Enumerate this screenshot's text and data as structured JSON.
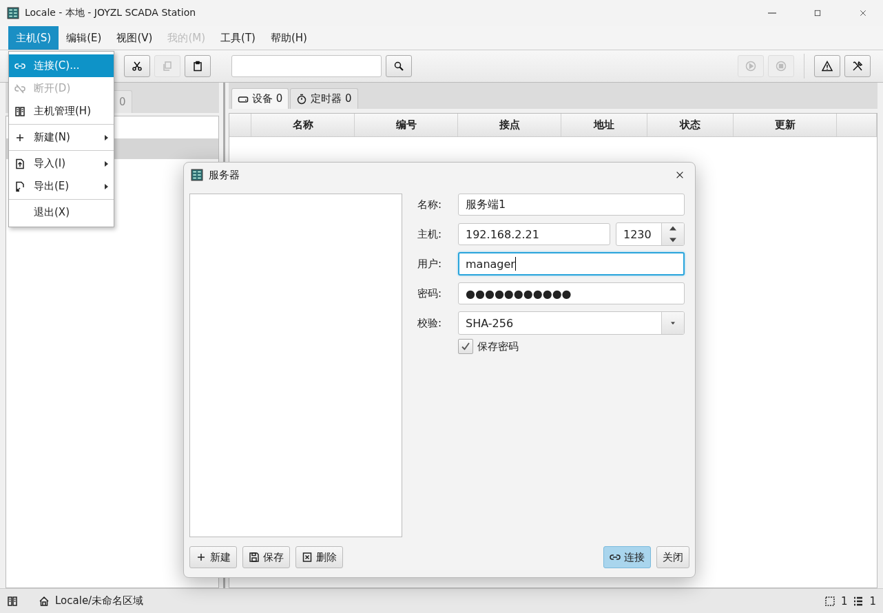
{
  "window": {
    "title": "Locale - 本地 - JOYZL SCADA Station"
  },
  "menubar": [
    {
      "label": "主机(S)",
      "selected": true,
      "disabled": false
    },
    {
      "label": "编辑(E)",
      "selected": false,
      "disabled": false
    },
    {
      "label": "视图(V)",
      "selected": false,
      "disabled": false
    },
    {
      "label": "我的(M)",
      "selected": false,
      "disabled": true
    },
    {
      "label": "工具(T)",
      "selected": false,
      "disabled": false
    },
    {
      "label": "帮助(H)",
      "selected": false,
      "disabled": false
    }
  ],
  "menu": {
    "items": [
      {
        "kind": "connect",
        "label": "连接(C)...",
        "selected": true,
        "disabled": false,
        "submenu": false
      },
      {
        "kind": "disconnect",
        "label": "断开(D)",
        "selected": false,
        "disabled": true,
        "submenu": false
      },
      {
        "kind": "manage",
        "label": "主机管理(H)",
        "selected": false,
        "disabled": false,
        "submenu": false
      },
      {
        "kind": "separator"
      },
      {
        "kind": "new",
        "label": "新建(N)",
        "selected": false,
        "disabled": false,
        "submenu": true
      },
      {
        "kind": "separator"
      },
      {
        "kind": "import",
        "label": "导入(I)",
        "selected": false,
        "disabled": false,
        "submenu": true
      },
      {
        "kind": "export",
        "label": "导出(E)",
        "selected": false,
        "disabled": false,
        "submenu": true
      },
      {
        "kind": "separator"
      },
      {
        "kind": "exit",
        "label": "退出(X)",
        "selected": false,
        "disabled": false,
        "submenu": false
      }
    ]
  },
  "toolbar": {
    "left": [
      {
        "kind": "cut",
        "disabled": false
      },
      {
        "kind": "copy",
        "disabled": true
      },
      {
        "kind": "paste",
        "disabled": false
      }
    ],
    "search": {
      "kind": "search"
    },
    "right": [
      {
        "kind": "play",
        "disabled": true
      },
      {
        "kind": "stop",
        "disabled": true
      },
      {
        "kind": "separator"
      },
      {
        "kind": "warning",
        "disabled": false
      },
      {
        "kind": "tools",
        "disabled": false
      }
    ]
  },
  "left_panel": {
    "tab": {
      "label": "0",
      "disabled": true
    }
  },
  "right_panel": {
    "tabs": [
      {
        "kind": "device",
        "label": "设备 0",
        "selected": true
      },
      {
        "kind": "timer",
        "label": "定时器 0",
        "selected": false
      }
    ],
    "table": {
      "columns": [
        "名称",
        "编号",
        "接点",
        "地址",
        "状态",
        "更新"
      ]
    }
  },
  "dialog": {
    "title": "服务器",
    "fields": [
      {
        "kind": "text",
        "label": "名称:",
        "value": "服务端1",
        "focused": false
      },
      {
        "kind": "host",
        "label": "主机:",
        "value": "192.168.2.21",
        "port": "1230",
        "focused": false
      },
      {
        "kind": "text",
        "label": "用户:",
        "value": "manager",
        "focused": true
      },
      {
        "kind": "text",
        "label": "密码:",
        "value": "●●●●●●●●●●●",
        "focused": false
      },
      {
        "kind": "select",
        "label": "校验:",
        "value": "SHA-256",
        "focused": false
      }
    ],
    "save_password": {
      "label": "保存密码",
      "checked": true
    },
    "left_buttons": [
      {
        "kind": "new",
        "label": "新建"
      },
      {
        "kind": "save",
        "label": "保存"
      },
      {
        "kind": "delete",
        "label": "删除"
      }
    ],
    "right_buttons": [
      {
        "kind": "connect",
        "label": "连接",
        "default": true
      },
      {
        "kind": "close",
        "label": "关闭",
        "default": false
      }
    ]
  },
  "status_bar": {
    "path": "Locale/未命名区域",
    "selection_count": "1",
    "list_count": "1"
  }
}
